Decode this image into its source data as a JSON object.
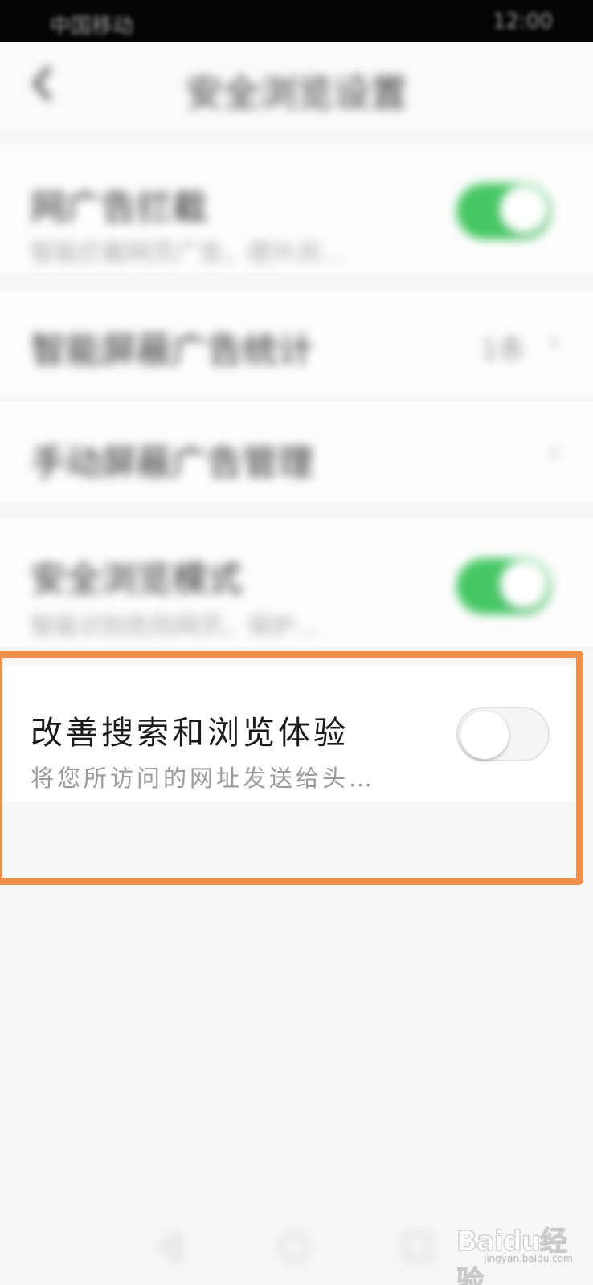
{
  "status_bar": {
    "left_text": "中国移动",
    "right_text": "12:00"
  },
  "header": {
    "title": "安全浏览设置"
  },
  "rows": [
    {
      "title": "网广告拦截",
      "subtitle": "智能拦截网页广告，提升浏…",
      "toggle": "on"
    },
    {
      "title": "智能屏蔽广告统计",
      "value": "1条"
    },
    {
      "title": "手动屏蔽广告管理"
    },
    {
      "title": "安全浏览模式",
      "subtitle": "智能识别危险网页，保护…",
      "toggle": "on"
    }
  ],
  "highlighted_setting": {
    "title": "改善搜索和浏览体验",
    "subtitle": "将您所访问的网址发送给头…",
    "toggle": "off"
  },
  "watermark": {
    "brand": "Baidu经验",
    "url": "jingyan.baidu.com"
  },
  "colors": {
    "toggle_on": "#46c764",
    "highlight_border": "#ef8f4a"
  },
  "icons": [
    "back-arrow-icon",
    "nav-back-icon",
    "nav-home-icon",
    "nav-recents-icon"
  ]
}
